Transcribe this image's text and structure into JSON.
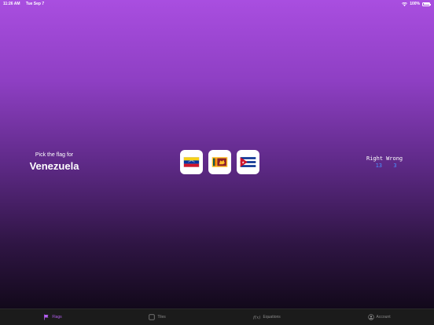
{
  "status": {
    "time": "11:26 AM",
    "date": "Tue Sep 7",
    "battery": "100%"
  },
  "prompt": {
    "label": "Pick the flag for",
    "country": "Venezuela"
  },
  "flags": [
    {
      "name": "venezuela-flag-icon"
    },
    {
      "name": "sri-lanka-flag-icon"
    },
    {
      "name": "cuba-flag-icon"
    }
  ],
  "score": {
    "right_label": "Right",
    "wrong_label": "Wrong",
    "right": "13",
    "wrong": "3"
  },
  "tabs": [
    {
      "label": "Flags",
      "icon": "flag-icon",
      "active": true
    },
    {
      "label": "Tiles",
      "icon": "tile-icon",
      "active": false
    },
    {
      "label": "Equations",
      "icon": "function-icon",
      "active": false
    },
    {
      "label": "Account",
      "icon": "account-icon",
      "active": false
    }
  ],
  "colors": {
    "accent": "#b45ff0",
    "score_values": "#4a90ff",
    "tab_bar": "#1b1b1b"
  }
}
